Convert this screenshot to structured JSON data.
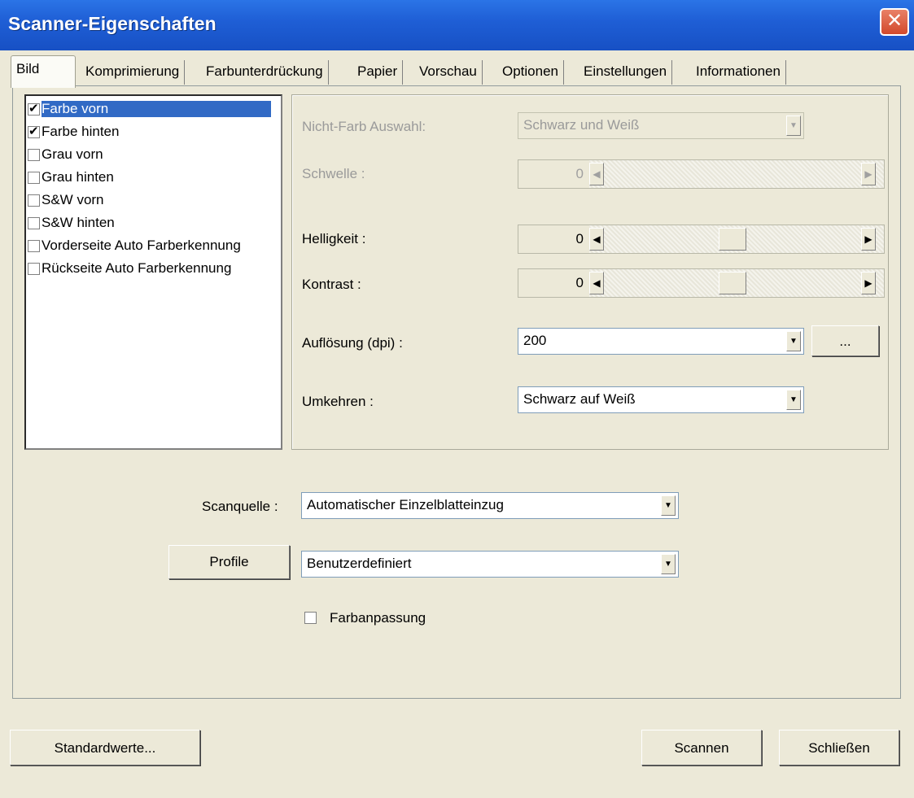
{
  "window": {
    "title": "Scanner-Eigenschaften",
    "close_glyph": "✕"
  },
  "tabs": [
    {
      "label": "Bild"
    },
    {
      "label": "Komprimierung"
    },
    {
      "label": "Farbunterdrückung"
    },
    {
      "label": "Papier"
    },
    {
      "label": "Vorschau"
    },
    {
      "label": "Optionen"
    },
    {
      "label": "Einstellungen"
    },
    {
      "label": "Informationen"
    }
  ],
  "image_list": [
    {
      "label": "Farbe vorn",
      "checked": true,
      "selected": true
    },
    {
      "label": "Farbe hinten",
      "checked": true,
      "selected": false
    },
    {
      "label": "Grau vorn",
      "checked": false,
      "selected": false
    },
    {
      "label": "Grau hinten",
      "checked": false,
      "selected": false
    },
    {
      "label": "S&W vorn",
      "checked": false,
      "selected": false
    },
    {
      "label": "S&W hinten",
      "checked": false,
      "selected": false
    },
    {
      "label": "Vorderseite Auto Farberkennung",
      "checked": false,
      "selected": false
    },
    {
      "label": "Rückseite Auto Farberkennung",
      "checked": false,
      "selected": false
    }
  ],
  "settings": {
    "nonfarb": {
      "label": "Nicht-Farb Auswahl:",
      "value": "Schwarz und Weiß",
      "enabled": false
    },
    "schwelle": {
      "label": "Schwelle :",
      "value": "0",
      "enabled": false
    },
    "helligkeit": {
      "label": "Helligkeit :",
      "value": "0",
      "level": 0.5
    },
    "kontrast": {
      "label": "Kontrast :",
      "value": "0",
      "level": 0.5
    },
    "aufloesung": {
      "label": "Auflösung (dpi) :",
      "value": "200",
      "more_label": "..."
    },
    "umkehren": {
      "label": "Umkehren :",
      "value": "Schwarz auf Weiß"
    }
  },
  "scan": {
    "source_label": "Scanquelle :",
    "source_value": "Automatischer Einzelblatteinzug",
    "profile_button": "Profile",
    "profile_value": "Benutzerdefiniert",
    "color_match_label": "Farbanpassung",
    "color_match_checked": false
  },
  "buttons": {
    "defaults": "Standardwerte...",
    "scan": "Scannen",
    "close": "Schließen"
  },
  "colors": {
    "titlebar": "#1f5fd6",
    "face": "#ece9d8",
    "selection": "#316ac5",
    "close": "#d2492b"
  }
}
